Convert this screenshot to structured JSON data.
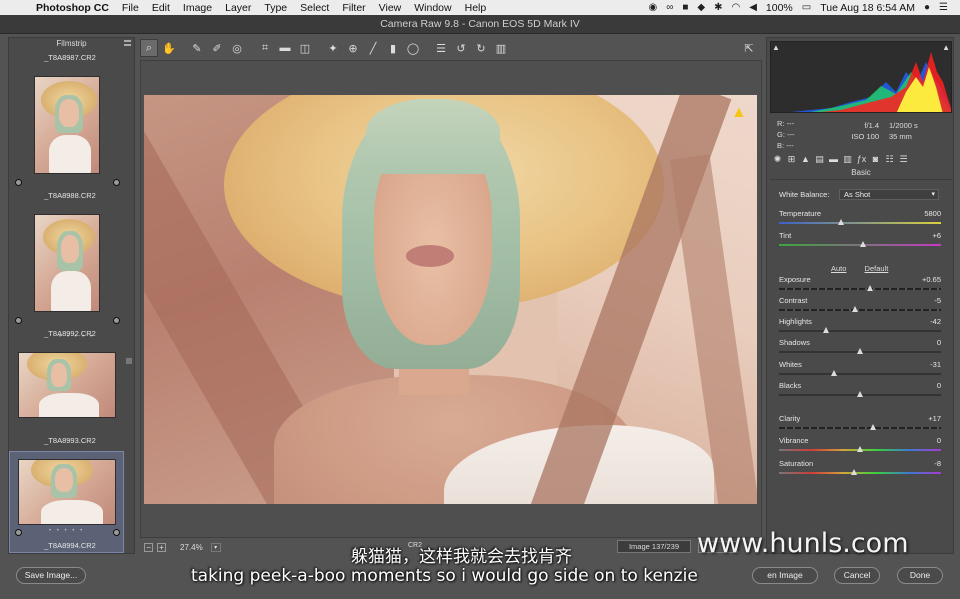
{
  "menubar": {
    "app": "Photoshop CC",
    "items": [
      "File",
      "Edit",
      "Image",
      "Layer",
      "Type",
      "Select",
      "Filter",
      "View",
      "Window",
      "Help"
    ],
    "battery": "100%",
    "datetime": "Tue Aug 18  6:54 AM"
  },
  "window": {
    "title": "Camera Raw 9.8  -  Canon EOS 5D Mark IV"
  },
  "filmstrip": {
    "title": "Filmstrip",
    "items": [
      {
        "name": "_T8A8987.CR2"
      },
      {
        "name": "_T8A8988.CR2"
      },
      {
        "name": "_T8A8992.CR2"
      },
      {
        "name": "_T8A8993.CR2"
      },
      {
        "name": "_T8A8994.CR2"
      }
    ],
    "stars": "• • • • •"
  },
  "toolbar": {
    "tools": [
      "zoom-icon",
      "hand-icon",
      "white-balance-icon",
      "color-sampler-icon",
      "target-adjust-icon",
      "crop-icon",
      "straighten-icon",
      "transform-icon",
      "spot-removal-icon",
      "red-eye-icon",
      "adjustment-brush-icon",
      "graduated-filter-icon",
      "radial-filter-icon",
      "preferences-icon",
      "rotate-left-icon",
      "rotate-right-icon",
      "trash-icon"
    ]
  },
  "preview": {
    "zoom": "27.4%",
    "filename_partial": "CR2",
    "image_count": "Image 137/239"
  },
  "histogram": {
    "rgb": {
      "r": "R:   ---",
      "g": "G:   ---",
      "b": "B:   ---"
    },
    "aperture": "f/1.4",
    "shutter": "1/2000 s",
    "iso": "ISO 100",
    "focal": "35 mm"
  },
  "basic": {
    "title": "Basic",
    "white_balance_label": "White Balance:",
    "white_balance_value": "As Shot",
    "auto": "Auto",
    "default": "Default",
    "sliders": [
      {
        "label": "Temperature",
        "value": "5800",
        "pos": 0.38
      },
      {
        "label": "Tint",
        "value": "+6",
        "pos": 0.52
      },
      {
        "label": "Exposure",
        "value": "+0.65",
        "pos": 0.56
      },
      {
        "label": "Contrast",
        "value": "-5",
        "pos": 0.47
      },
      {
        "label": "Highlights",
        "value": "-42",
        "pos": 0.29
      },
      {
        "label": "Shadows",
        "value": "0",
        "pos": 0.5
      },
      {
        "label": "Whites",
        "value": "-31",
        "pos": 0.34
      },
      {
        "label": "Blacks",
        "value": "0",
        "pos": 0.5
      },
      {
        "label": "Clarity",
        "value": "+17",
        "pos": 0.58
      },
      {
        "label": "Vibrance",
        "value": "0",
        "pos": 0.5
      },
      {
        "label": "Saturation",
        "value": "-8",
        "pos": 0.46
      }
    ]
  },
  "buttons": {
    "save": "Save Image...",
    "open": "en Image",
    "cancel": "Cancel",
    "done": "Done"
  },
  "captions": {
    "chinese": "躲猫猫，这样我就会去找肯齐",
    "english": "taking peek-a-boo moments so i would go side on to kenzie",
    "watermark": "www.hunls.com"
  }
}
